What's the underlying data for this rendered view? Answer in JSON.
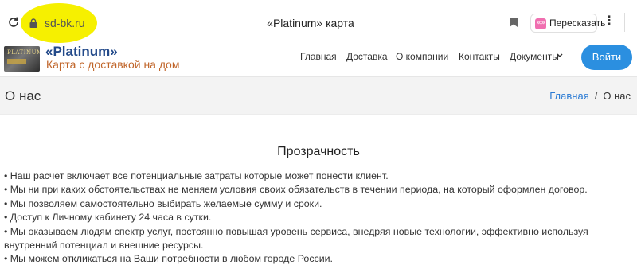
{
  "browser": {
    "domain": "sd-bk.ru",
    "tab_title": "«Platinum» карта",
    "retell_label": "Пересказать",
    "retell_badge": "«»",
    "menu_glyph": "⋮",
    "highlight_color": "#f6f000"
  },
  "site": {
    "logo_text": "PLATINUM",
    "brand_name": "«Platinum»",
    "brand_sub": "Карта с доставкой на дом",
    "nav": [
      {
        "label": "Главная"
      },
      {
        "label": "Доставка"
      },
      {
        "label": "О компании"
      },
      {
        "label": "Контакты"
      },
      {
        "label": "Документы"
      }
    ],
    "login_label": "Войти",
    "accent_color": "#2b8fe0"
  },
  "heading": {
    "title": "О нас",
    "breadcrumb_home": "Главная",
    "breadcrumb_sep": "/",
    "breadcrumb_current": "О нас"
  },
  "content": {
    "title": "Прозрачность",
    "bullets": [
      "• Наш расчет включает все потенциальные затраты которые может понести клиент.",
      "• Мы ни при каких обстоятельствах не меняем условия своих обязательств в течении периода, на который оформлен договор.",
      "• Мы позволяем самостоятельно выбирать желаемые сумму и сроки.",
      "• Доступ к Личному кабинету 24 часа в сутки.",
      "• Мы оказываем людям спектр услуг, постоянно повышая уровень сервиса, внедряя новые технологии, эффективно используя внутренний потенциал и внешние ресурсы.",
      "• Мы можем откликаться на Ваши потребности в любом городе России."
    ]
  }
}
